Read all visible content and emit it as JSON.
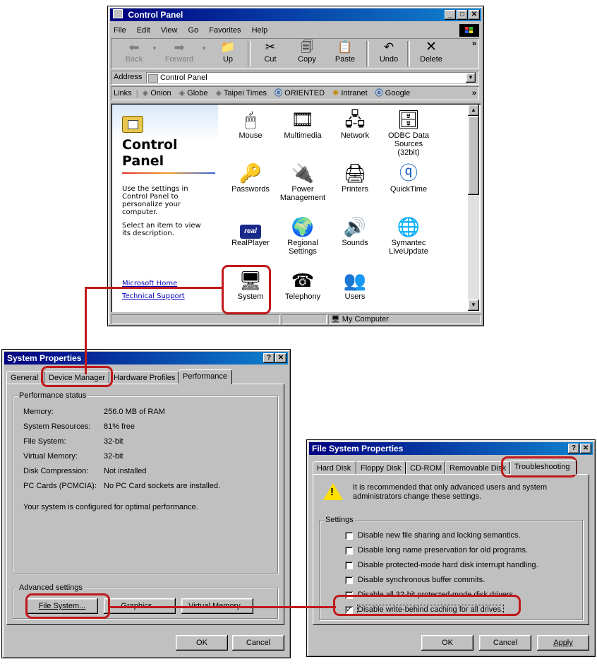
{
  "control_panel": {
    "title": "Control Panel",
    "menu": [
      "File",
      "Edit",
      "View",
      "Go",
      "Favorites",
      "Help"
    ],
    "toolbar": {
      "back": "Back",
      "forward": "Forward",
      "up": "Up",
      "cut": "Cut",
      "copy": "Copy",
      "paste": "Paste",
      "undo": "Undo",
      "delete": "Delete"
    },
    "address_label": "Address",
    "address_value": "Control Panel",
    "links_label": "Links",
    "links": [
      "Onion",
      "Globe",
      "Taipei Times",
      "ORIENTED",
      "Intranet",
      "Google"
    ],
    "side": {
      "heading1": "Control",
      "heading2": "Panel",
      "desc1": "Use the settings in Control Panel to personalize your computer.",
      "desc2": "Select an item to view its description.",
      "link1": "Microsoft Home",
      "link2": "Technical Support"
    },
    "icons": [
      {
        "label1": "Mouse",
        "label2": "",
        "icon": "mouse-icon"
      },
      {
        "label1": "Multimedia",
        "label2": "",
        "icon": "multimedia-icon"
      },
      {
        "label1": "Network",
        "label2": "",
        "icon": "network-icon"
      },
      {
        "label1": "ODBC Data",
        "label2": "Sources (32bit)",
        "icon": "odbc-icon"
      },
      {
        "label1": "Passwords",
        "label2": "",
        "icon": "keys-icon"
      },
      {
        "label1": "Power",
        "label2": "Management",
        "icon": "power-icon"
      },
      {
        "label1": "Printers",
        "label2": "",
        "icon": "printer-folder-icon"
      },
      {
        "label1": "QuickTime",
        "label2": "",
        "icon": "quicktime-icon"
      },
      {
        "label1": "RealPlayer",
        "label2": "",
        "icon": "realplayer-icon"
      },
      {
        "label1": "Regional",
        "label2": "Settings",
        "icon": "globe-icon"
      },
      {
        "label1": "Sounds",
        "label2": "",
        "icon": "speaker-icon"
      },
      {
        "label1": "Symantec",
        "label2": "LiveUpdate",
        "icon": "liveupdate-icon"
      },
      {
        "label1": "System",
        "label2": "",
        "icon": "computer-icon"
      },
      {
        "label1": "Telephony",
        "label2": "",
        "icon": "telephone-icon"
      },
      {
        "label1": "Users",
        "label2": "",
        "icon": "users-icon"
      }
    ],
    "status": "My Computer"
  },
  "system_properties": {
    "title": "System Properties",
    "tabs": [
      "General",
      "Device Manager",
      "Hardware Profiles",
      "Performance"
    ],
    "status_group": "Performance status",
    "rows": [
      {
        "k": "Memory:",
        "v": "256.0 MB of RAM"
      },
      {
        "k": "System Resources:",
        "v": "81% free"
      },
      {
        "k": "File System:",
        "v": "32-bit"
      },
      {
        "k": "Virtual Memory:",
        "v": "32-bit"
      },
      {
        "k": "Disk Compression:",
        "v": "Not installed"
      },
      {
        "k": "PC Cards (PCMCIA):",
        "v": "No PC Card sockets are installed."
      }
    ],
    "note": "Your system is configured for optimal performance.",
    "adv_group": "Advanced settings",
    "btn_fs": "File System...",
    "btn_graphics": "Graphics...",
    "btn_vm": "Virtual Memory...",
    "ok": "OK",
    "cancel": "Cancel"
  },
  "fs_properties": {
    "title": "File System Properties",
    "tabs": [
      "Hard Disk",
      "Floppy Disk",
      "CD-ROM",
      "Removable Disk",
      "Troubleshooting"
    ],
    "warning": "It is recommended that only advanced users and system administrators change these settings.",
    "settings_group": "Settings",
    "options": [
      {
        "label": "Disable new file sharing and locking semantics.",
        "checked": false
      },
      {
        "label": "Disable long name preservation for old programs.",
        "checked": false
      },
      {
        "label": "Disable protected-mode hard disk interrupt handling.",
        "checked": false
      },
      {
        "label": "Disable synchronous buffer commits.",
        "checked": false
      },
      {
        "label": "Disable all 32-bit protected-mode disk drivers.",
        "checked": false
      },
      {
        "label": "Disable write-behind caching for all drives.",
        "checked": true
      }
    ],
    "ok": "OK",
    "cancel": "Cancel",
    "apply": "Apply"
  }
}
